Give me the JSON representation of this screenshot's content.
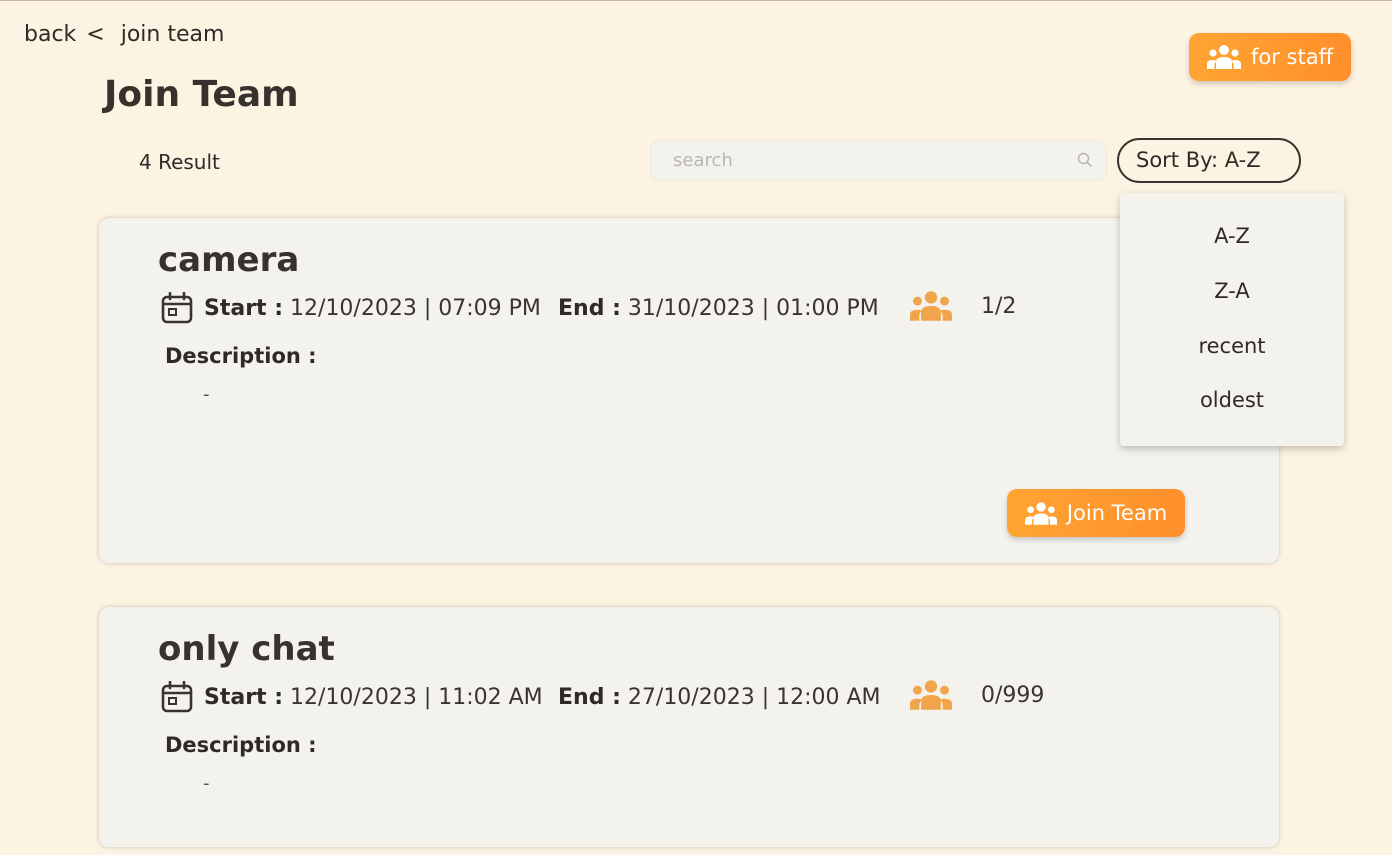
{
  "breadcrumb": {
    "back": "back",
    "separator": "<",
    "current": "join team"
  },
  "header": {
    "title": "Join Team",
    "staff_button": "for staff"
  },
  "results": {
    "label": "4 Result"
  },
  "search": {
    "placeholder": "search"
  },
  "sort": {
    "label": "Sort By: A-Z",
    "options": [
      "A-Z",
      "Z-A",
      "recent",
      "oldest"
    ]
  },
  "colors": {
    "accent": "#ff9a2f",
    "people_icon": "#f0a54a",
    "background": "#fdf3e3",
    "card": "#f4f2ed"
  },
  "teams": [
    {
      "name": "camera",
      "start_label": "Start :",
      "start": "12/10/2023 | 07:09 PM",
      "end_label": "End :",
      "end": "31/10/2023 | 01:00 PM",
      "members": "1/2",
      "description_label": "Description :",
      "description": "-",
      "join_label": "Join Team"
    },
    {
      "name": "only chat",
      "start_label": "Start :",
      "start": "12/10/2023 | 11:02 AM",
      "end_label": "End :",
      "end": "27/10/2023 | 12:00 AM",
      "members": "0/999",
      "description_label": "Description :",
      "description": "-"
    }
  ]
}
